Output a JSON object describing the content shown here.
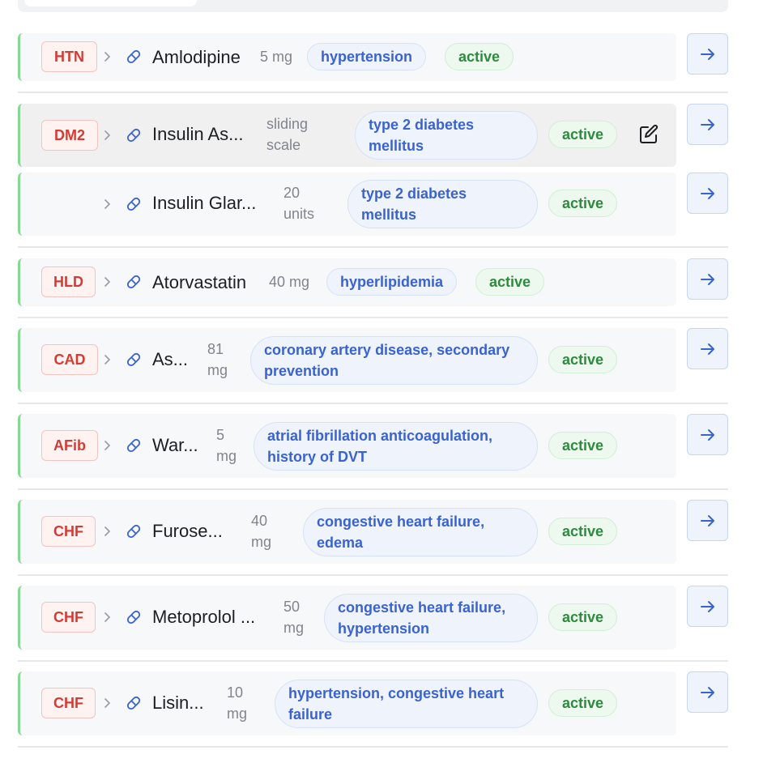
{
  "rows": [
    {
      "cond": "HTN",
      "name": "Amlodipine",
      "dose": "5 mg",
      "indication": "hypertension",
      "status": "active"
    },
    {
      "cond": "DM2",
      "name": "Insulin As...",
      "dose": "sliding scale",
      "indication": "type 2 diabetes mellitus",
      "status": "active"
    },
    {
      "cond": "",
      "name": "Insulin Glar...",
      "dose": "20 units",
      "indication": "type 2 diabetes mellitus",
      "status": "active"
    },
    {
      "cond": "HLD",
      "name": "Atorvastatin",
      "dose": "40 mg",
      "indication": "hyperlipidemia",
      "status": "active"
    },
    {
      "cond": "CAD",
      "name": "As...",
      "dose": "81 mg",
      "indication": "coronary artery disease, secondary prevention",
      "status": "active"
    },
    {
      "cond": "AFib",
      "name": "War...",
      "dose": "5 mg",
      "indication": "atrial fibrillation anticoagulation, history of DVT",
      "status": "active"
    },
    {
      "cond": "CHF",
      "name": "Furose...",
      "dose": "40 mg",
      "indication": "congestive heart failure, edema",
      "status": "active"
    },
    {
      "cond": "CHF",
      "name": "Metoprolol ...",
      "dose": "50 mg",
      "indication": "congestive heart failure, hypertension",
      "status": "active"
    },
    {
      "cond": "CHF",
      "name": "Lisin...",
      "dose": "10 mg",
      "indication": "hypertension, congestive heart failure",
      "status": "active"
    }
  ],
  "icons": {
    "expand": "chevron-right-icon",
    "medication": "pill-icon",
    "edit": "edit-icon",
    "open": "arrow-right-icon"
  },
  "colors": {
    "condition": "#d43b35",
    "indication": "#3a63cf",
    "status": "#2e8a3e",
    "active_border": "#86d994"
  }
}
